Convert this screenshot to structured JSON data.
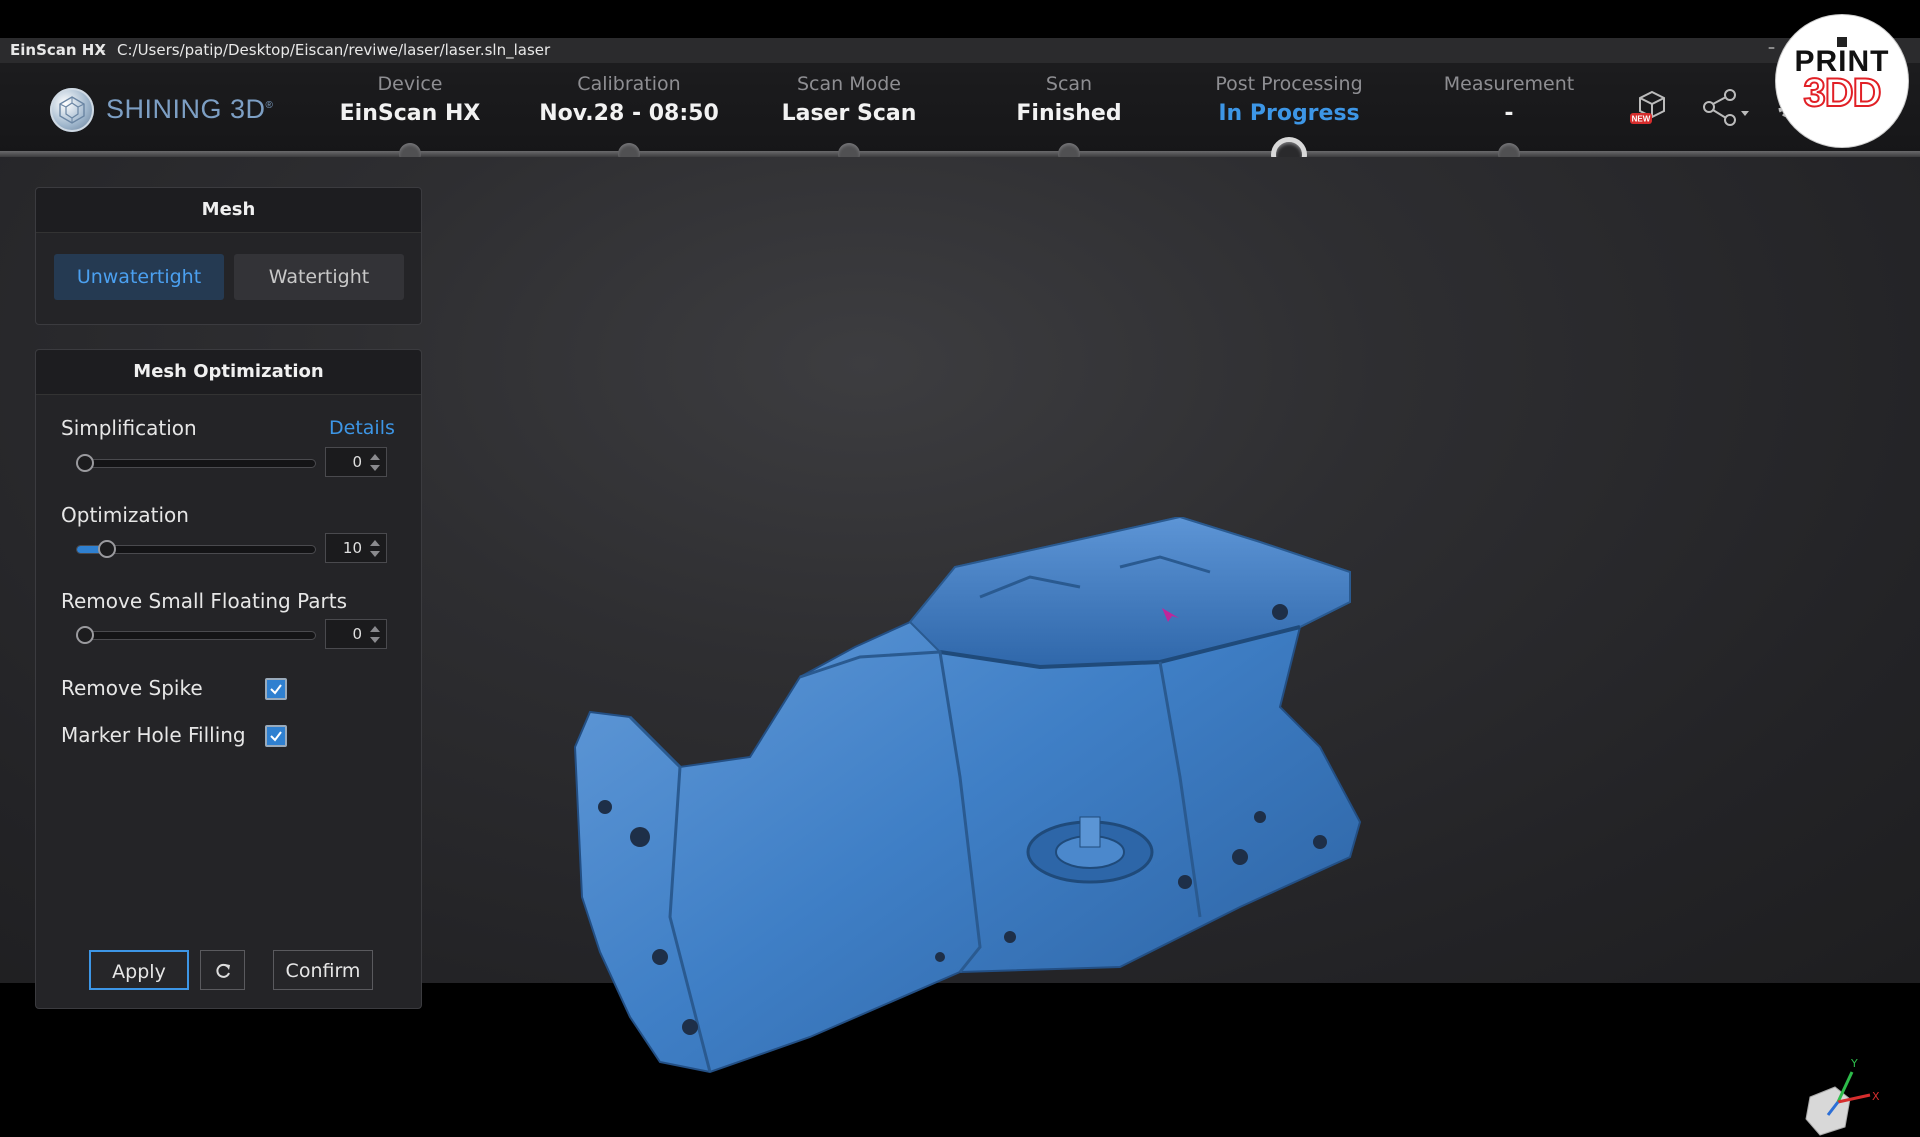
{
  "window": {
    "app_name": "EinScan HX",
    "separator": "-",
    "file_path": "C:/Users/patip/Desktop/Eiscan/reviwe/laser/laser.sln_laser",
    "minimize_glyph": "–"
  },
  "brand": {
    "name": "SHINING 3D",
    "mark": "®"
  },
  "steps": [
    {
      "label": "Device",
      "value": "EinScan HX",
      "state": "done"
    },
    {
      "label": "Calibration",
      "value": "Nov.28 - 08:50",
      "state": "done"
    },
    {
      "label": "Scan Mode",
      "value": "Laser Scan",
      "state": "done"
    },
    {
      "label": "Scan",
      "value": "Finished",
      "state": "done"
    },
    {
      "label": "Post Processing",
      "value": "In Progress",
      "state": "active"
    },
    {
      "label": "Measurement",
      "value": "-",
      "state": "pending"
    }
  ],
  "header_icons": {
    "new_badge": "NEW",
    "icons": [
      "model-new-icon",
      "share-icon",
      "settings-icon"
    ]
  },
  "watermark": {
    "line1": "PRINT",
    "line2": "3DD"
  },
  "mesh_panel": {
    "title": "Mesh",
    "options": [
      "Unwatertight",
      "Watertight"
    ],
    "selected": "Unwatertight"
  },
  "optimization_panel": {
    "title": "Mesh Optimization",
    "details_link": "Details",
    "simplification": {
      "label": "Simplification",
      "value": "0",
      "level": 0
    },
    "optimization": {
      "label": "Optimization",
      "value": "10",
      "level": 0.1
    },
    "remove_floating": {
      "label": "Remove Small Floating Parts",
      "value": "0",
      "level": 0
    },
    "remove_spike": {
      "label": "Remove Spike",
      "checked": true
    },
    "marker_hole_filling": {
      "label": "Marker Hole Filling",
      "checked": true
    },
    "buttons": {
      "apply": "Apply",
      "confirm": "Confirm"
    }
  },
  "axis_labels": {
    "y": "Y",
    "x": "X"
  },
  "colors": {
    "accent": "#3d96e6",
    "model": "#3a78bd",
    "watermark_red": "#e12026"
  }
}
